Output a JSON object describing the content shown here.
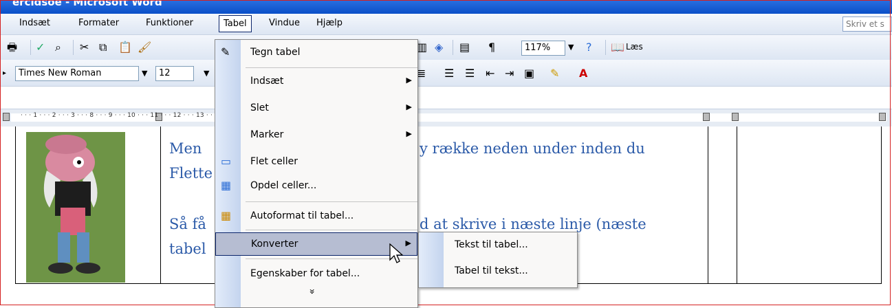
{
  "window": {
    "title": "ercidsoe - Microsoft Word"
  },
  "menubar": {
    "items": [
      "Indsæt",
      "Formater",
      "Funktioner",
      "Tabel",
      "Vindue",
      "Hjælp"
    ],
    "help_placeholder": "Skriv et s"
  },
  "toolbar": {
    "zoom": "117%",
    "read_label": "Læs"
  },
  "format_bar": {
    "font": "Times New Roman",
    "size": "12"
  },
  "ruler": {
    "ticks": "· · · 1 · · · 2 · · ·   3 · · ·                             8 · · · 9 · · · 10 · · · 11 · · · 12 · · · 13 · ·      14 · · · 15 · · · 16 · · · ·"
  },
  "document": {
    "line1a": "Men",
    "line1b": "y række neden under inden du",
    "line2": "Flette",
    "line3a": "Så få",
    "line3b": "d at skrive i næste linje (næste",
    "line4": "tabel"
  },
  "tabel_menu": {
    "items": [
      {
        "label": "Tegn tabel",
        "icon": "pencil-icon"
      },
      {
        "label": "Indsæt",
        "submenu": true
      },
      {
        "label": "Slet",
        "submenu": true
      },
      {
        "label": "Marker",
        "submenu": true
      },
      {
        "label": "Flet celler",
        "icon": "merge-cells-icon"
      },
      {
        "label": "Opdel celler...",
        "icon": "split-cells-icon"
      },
      {
        "label": "Autoformat til tabel...",
        "icon": "autoformat-icon"
      },
      {
        "label": "Konverter",
        "submenu": true,
        "highlighted": true
      },
      {
        "label": "Egenskaber for tabel..."
      }
    ],
    "expand_glyph": "»"
  },
  "konverter_submenu": {
    "items": [
      "Tekst til tabel...",
      "Tabel til tekst..."
    ]
  },
  "colors": {
    "accent": "#0a246a",
    "text_blue": "#2b5aa8",
    "highlight": "#b6bdd2"
  }
}
